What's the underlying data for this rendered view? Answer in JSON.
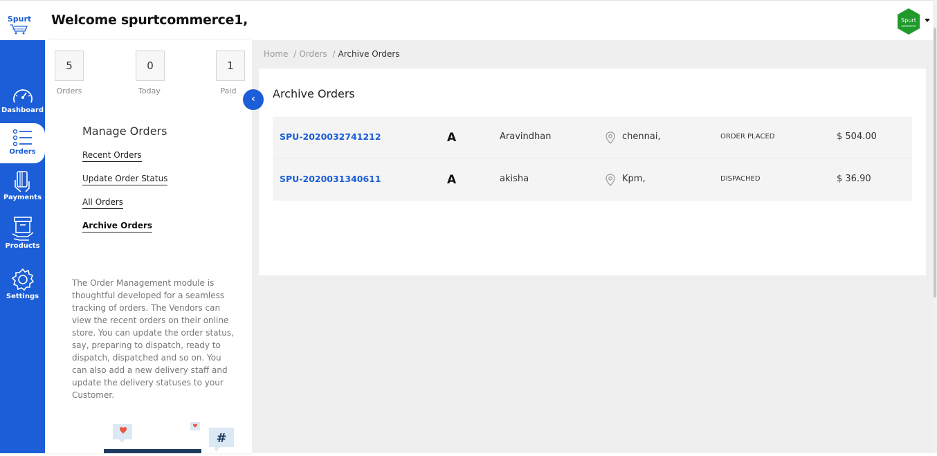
{
  "header": {
    "welcome": "Welcome spurtcommerce1,",
    "logo_text": "Spurt",
    "logo_sub": "commerce",
    "avatar_text": "Spurt",
    "avatar_sub": "commerce",
    "registered_mark": "®"
  },
  "rail": {
    "items": [
      {
        "label": "Dashboard",
        "icon": "gauge-icon"
      },
      {
        "label": "Orders",
        "icon": "list-icon",
        "active": true
      },
      {
        "label": "Payments",
        "icon": "card-hand-icon"
      },
      {
        "label": "Products",
        "icon": "box-hand-icon"
      },
      {
        "label": "Settings",
        "icon": "gear-icon"
      }
    ]
  },
  "panel": {
    "stats": [
      {
        "value": "5",
        "label": "Orders"
      },
      {
        "value": "0",
        "label": "Today"
      },
      {
        "value": "1",
        "label": "Paid"
      }
    ],
    "collapse_icon": "‹",
    "manage_title": "Manage Orders",
    "links": [
      "Recent Orders",
      "Update Order Status",
      "All Orders",
      "Archive Orders"
    ],
    "active_link": "Archive Orders",
    "description": "The Order Management module is thoughtful developed for a seamless tracking of orders. The Vendors can view the recent orders on their online store. You can update the order status, say, preparing to dispatch, ready to dispatch, dispatched and so on. You can also add a new delivery staff and update the delivery statuses to your Customer.",
    "illustration_symbol": "#"
  },
  "breadcrumb": {
    "items": [
      "Home",
      "Orders",
      "Archive Orders"
    ],
    "separator": "/"
  },
  "main": {
    "title": "Archive Orders",
    "orders": [
      {
        "id": "SPU-2020032741212",
        "initial": "A",
        "customer": "Aravindhan",
        "city": "chennai,",
        "status": "ORDER PLACED",
        "amount": "$ 504.00"
      },
      {
        "id": "SPU-2020031340611",
        "initial": "A",
        "customer": "akisha",
        "city": "Kpm,",
        "status": "DISPACHED",
        "amount": "$ 36.90"
      }
    ]
  },
  "colors": {
    "primary": "#1b5ed7",
    "avatar_green": "#1f9a2b",
    "background": "#efefef"
  }
}
